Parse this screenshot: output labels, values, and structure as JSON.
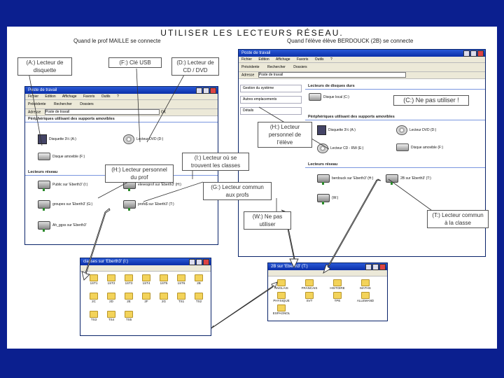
{
  "slide": {
    "title": "UTILISER LES LECTEURS RÉSEAU.",
    "subtitle_left": "Quand le prof MAILLE se connecte",
    "subtitle_right": "Quand l'élève élève BERDOUCK (2B) se connecte"
  },
  "notes": {
    "a": "(A:) Lecteur de disquette",
    "f": "(F:) Clé USB",
    "d": "(D:) Lecteur de CD / DVD",
    "h_prof": "(H:) Lecteur personnel du prof",
    "i": "(I:) Lecteur où se trouvent les classes",
    "g": "(G:) Lecteur commun aux profs",
    "c": "(C:) Ne pas utiliser !",
    "h_eleve": "(H:) Lecteur personnel de l'élève",
    "w": "(W:) Ne pas utiliser",
    "t": "(T:) Lecteur commun à la classe"
  },
  "window_prof": {
    "title": "Poste de travail",
    "menu": [
      "Fichier",
      "Edition",
      "Affichage",
      "Favoris",
      "Outils",
      "?"
    ],
    "toolbar": [
      "Précédente",
      "Rechercher",
      "Dossiers"
    ],
    "address_label": "Adresse",
    "address_value": "Poste de travail",
    "go": "OK",
    "section_removable": "Périphériques utilisant des supports amovibles",
    "section_network": "Lecteurs réseau",
    "items": {
      "a": "Disquette 3½ (A:)",
      "dvd": "Lecteur DVD (D:)",
      "f": "Disque amovible (F:)",
      "n1": "Public sur 'Eberth3' (I:)",
      "n2": "elevesprof sur 'Eberth3' (H:)",
      "n3": "groupes sur 'Eberth3' (G:)",
      "n4": "profs$ sur 'Eberth3' (T:)",
      "n5": "Ah_ggss sur 'Eberth3'"
    }
  },
  "window_eleve": {
    "title": "Poste de travail",
    "menu": [
      "Fichier",
      "Edition",
      "Affichage",
      "Favoris",
      "Outils",
      "?"
    ],
    "toolbar": [
      "Précédente",
      "Rechercher",
      "Dossiers"
    ],
    "address_label": "Adresse",
    "address_value": "Poste de travail",
    "tasks": [
      "Gestion du système",
      "Autres emplacements",
      "Détails"
    ],
    "section_disks": "Lecteurs de disques durs",
    "section_removable": "Périphériques utilisant des supports amovibles",
    "section_network": "Lecteurs réseau",
    "items": {
      "c": "Disque local (C:)",
      "a": "Disquette 3½ (A:)",
      "dvd": "Lecteur DVD (D:)",
      "cd": "Lecteur CD - RW (E:)",
      "f": "Disque amovible (F:)",
      "n1": "berdouck sur 'Eberth3' (H:)",
      "n2": "2B sur 'Eberth3' (T:)",
      "n3": "(W:)"
    }
  },
  "window_bottom_left": {
    "title": "classes sur 'Eberth3' (I:)",
    "folders": [
      "1ST1",
      "1ST2",
      "1ST3",
      "1ST4",
      "1ST5",
      "1ST6",
      "2B",
      "2C",
      "2D",
      "2E",
      "2F",
      "2G",
      "TS1",
      "TS2",
      "TS3",
      "TS4",
      "TS5"
    ]
  },
  "window_bottom_right": {
    "title": "2B sur 'Eberth3' (T:)",
    "folders": [
      "ANGLAIS",
      "FRANCAIS",
      "HISTOIRE",
      "MATHS",
      "PHYSIQUE",
      "SVT",
      "TPE",
      "ALLEMAND",
      "ESPAGNOL"
    ]
  }
}
